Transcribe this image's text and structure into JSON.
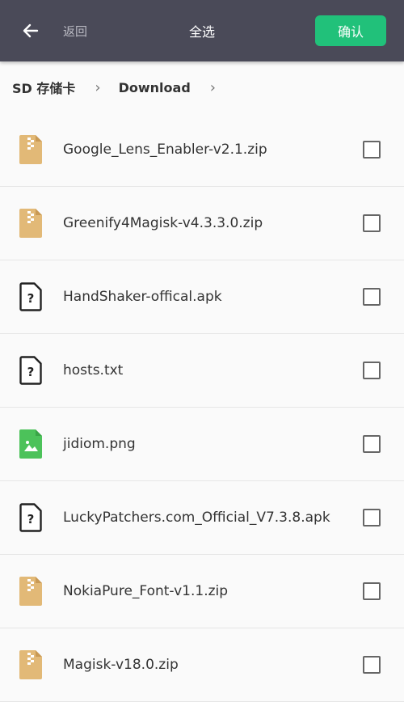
{
  "header": {
    "back_label": "返回",
    "select_all_label": "全选",
    "confirm_label": "确认",
    "accent_color": "#21c17a",
    "bar_color": "#4a4a58"
  },
  "breadcrumb": {
    "items": [
      "SD 存储卡",
      "Download"
    ]
  },
  "files": [
    {
      "name": "Google_Lens_Enabler-v2.1.zip",
      "icon": "zip-file-icon",
      "checked": false
    },
    {
      "name": "Greenify4Magisk-v4.3.3.0.zip",
      "icon": "zip-file-icon",
      "checked": false
    },
    {
      "name": "HandShaker-offical.apk",
      "icon": "unknown-file-icon",
      "checked": false
    },
    {
      "name": "hosts.txt",
      "icon": "unknown-file-icon",
      "checked": false
    },
    {
      "name": "jidiom.png",
      "icon": "image-file-icon",
      "checked": false
    },
    {
      "name": "LuckyPatchers.com_Official_V7.3.8.apk",
      "icon": "unknown-file-icon",
      "checked": false
    },
    {
      "name": "NokiaPure_Font-v1.1.zip",
      "icon": "zip-file-icon",
      "checked": false
    },
    {
      "name": "Magisk-v18.0.zip",
      "icon": "zip-file-icon",
      "checked": false
    }
  ]
}
